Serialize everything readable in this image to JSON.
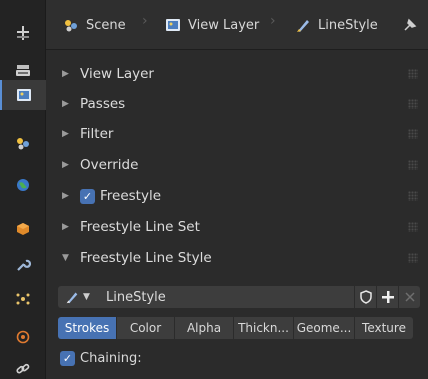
{
  "breadcrumb": {
    "items": [
      {
        "label": "Scene",
        "icon": "scene-icon"
      },
      {
        "label": "View Layer",
        "icon": "view-layer-icon"
      },
      {
        "label": "LineStyle",
        "icon": "brush-icon"
      }
    ],
    "pin_icon": "pin-icon"
  },
  "sidebar_tabs": [
    {
      "icon": "tool-icon"
    },
    {
      "icon": "render-icon"
    },
    {
      "icon": "output-icon"
    },
    {
      "icon": "view-layer-icon",
      "active": true
    },
    {
      "icon": "scene-icon"
    },
    {
      "icon": "world-icon"
    },
    {
      "icon": "object-icon"
    },
    {
      "icon": "modifier-wrench-icon"
    },
    {
      "icon": "particles-icon"
    },
    {
      "icon": "physics-icon"
    },
    {
      "icon": "constraints-icon"
    }
  ],
  "panels": [
    {
      "label": "View Layer",
      "expanded": false
    },
    {
      "label": "Passes",
      "expanded": false
    },
    {
      "label": "Filter",
      "expanded": false
    },
    {
      "label": "Override",
      "expanded": false
    },
    {
      "label": "Freestyle",
      "expanded": false,
      "checkbox": true
    },
    {
      "label": "Freestyle Line Set",
      "expanded": false
    },
    {
      "label": "Freestyle Line Style",
      "expanded": true
    }
  ],
  "linestyle": {
    "name": "LineStyle",
    "fake_user_icon": "shield-icon",
    "new_icon": "plus-icon",
    "unlink_icon": "x-icon"
  },
  "tabs": [
    "Strokes",
    "Color",
    "Alpha",
    "Thickn...",
    "Geome...",
    "Texture"
  ],
  "selected_tab": "Strokes",
  "chaining": {
    "label": "Chaining:",
    "checked": true
  },
  "colors": {
    "accent": "#4772b3",
    "panel_bg": "#2b2b2b",
    "header_bg": "#2f2f2f",
    "field_bg": "#3d3d3d"
  }
}
